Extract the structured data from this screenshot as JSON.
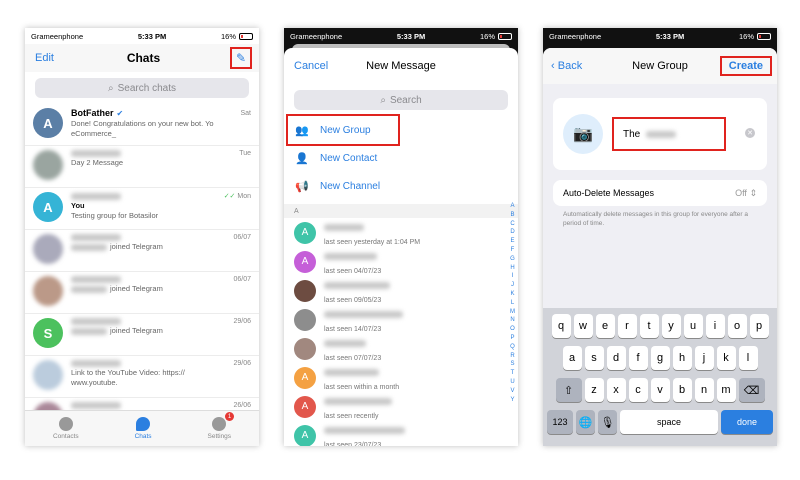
{
  "status": {
    "carrier": "Grameenphone",
    "time": "5:33 PM",
    "battery": "16%"
  },
  "screen1": {
    "edit": "Edit",
    "title": "Chats",
    "search_placeholder": "Search chats",
    "chats": [
      {
        "name": "BotFather",
        "time": "Sat",
        "msg": "Done! Congratulations on your new bot. Yo",
        "msg2": "eCommerce_",
        "avatar": "A",
        "color": "#5b7fa6"
      },
      {
        "name": "",
        "time": "Tue",
        "msg": "Day 2 Message",
        "msg2": "",
        "avatar": "",
        "color": "#9aa5a0"
      },
      {
        "name": "",
        "time": "Mon",
        "msg_top": "You",
        "msg": "Testing group for Botasilor",
        "avatar": "A",
        "color": "#35b4d6"
      },
      {
        "name": "",
        "time": "06/07",
        "msg": "joined Telegram",
        "avatar": "",
        "color": "#aab"
      },
      {
        "name": "",
        "time": "06/07",
        "msg": "joined Telegram",
        "avatar": "",
        "color": "#b98"
      },
      {
        "name": "",
        "time": "29/06",
        "msg": "joined Telegram",
        "avatar": "S",
        "color": "#4cc15e"
      },
      {
        "name": "",
        "time": "29/06",
        "msg": "Link to the YouTube Video: https://",
        "msg2": "www.youtube.",
        "avatar": "",
        "color": "#bcd"
      },
      {
        "name": "",
        "time": "26/06",
        "msg": "",
        "avatar": "",
        "color": "#a89"
      }
    ],
    "tabs": [
      {
        "label": "Contacts"
      },
      {
        "label": "Chats"
      },
      {
        "label": "Settings",
        "badge": "1"
      }
    ]
  },
  "screen2": {
    "cancel": "Cancel",
    "title": "New Message",
    "search_placeholder": "Search",
    "menu": [
      "New Group",
      "New Contact",
      "New Channel"
    ],
    "section": "A",
    "contacts": [
      {
        "seen": "last seen yesterday at 1:04 PM",
        "avatar": "A",
        "color": "#3fc4a8"
      },
      {
        "seen": "last seen 04/07/23",
        "avatar": "A",
        "color": "#c55fd8"
      },
      {
        "seen": "last seen 09/05/23",
        "avatar": "",
        "color": "#6d4c41"
      },
      {
        "seen": "last seen 14/07/23",
        "avatar": "",
        "color": "#8d8d8d"
      },
      {
        "seen": "last seen 07/07/23",
        "avatar": "",
        "color": "#a1887f"
      },
      {
        "seen": "last seen within a month",
        "avatar": "A",
        "color": "#f4a142"
      },
      {
        "seen": "last seen recently",
        "avatar": "A",
        "color": "#e2574c"
      },
      {
        "seen": "last seen 23/07/23",
        "avatar": "A",
        "color": "#3fc4a8"
      }
    ],
    "alphabet": [
      "A",
      "B",
      "C",
      "D",
      "E",
      "F",
      "G",
      "H",
      "I",
      "J",
      "K",
      "L",
      "M",
      "N",
      "O",
      "P",
      "Q",
      "R",
      "S",
      "T",
      "U",
      "V",
      "Y"
    ]
  },
  "screen3": {
    "back": "Back",
    "title": "New Group",
    "create": "Create",
    "group_name": "The",
    "setting_label": "Auto-Delete Messages",
    "setting_value": "Off",
    "note": "Automatically delete messages in this group for everyone after a period of time.",
    "keys_row1": [
      "q",
      "w",
      "e",
      "r",
      "t",
      "y",
      "u",
      "i",
      "o",
      "p"
    ],
    "keys_row2": [
      "a",
      "s",
      "d",
      "f",
      "g",
      "h",
      "j",
      "k",
      "l"
    ],
    "keys_row3": [
      "z",
      "x",
      "c",
      "v",
      "b",
      "n",
      "m"
    ],
    "key_123": "123",
    "key_space": "space",
    "key_done": "done"
  }
}
